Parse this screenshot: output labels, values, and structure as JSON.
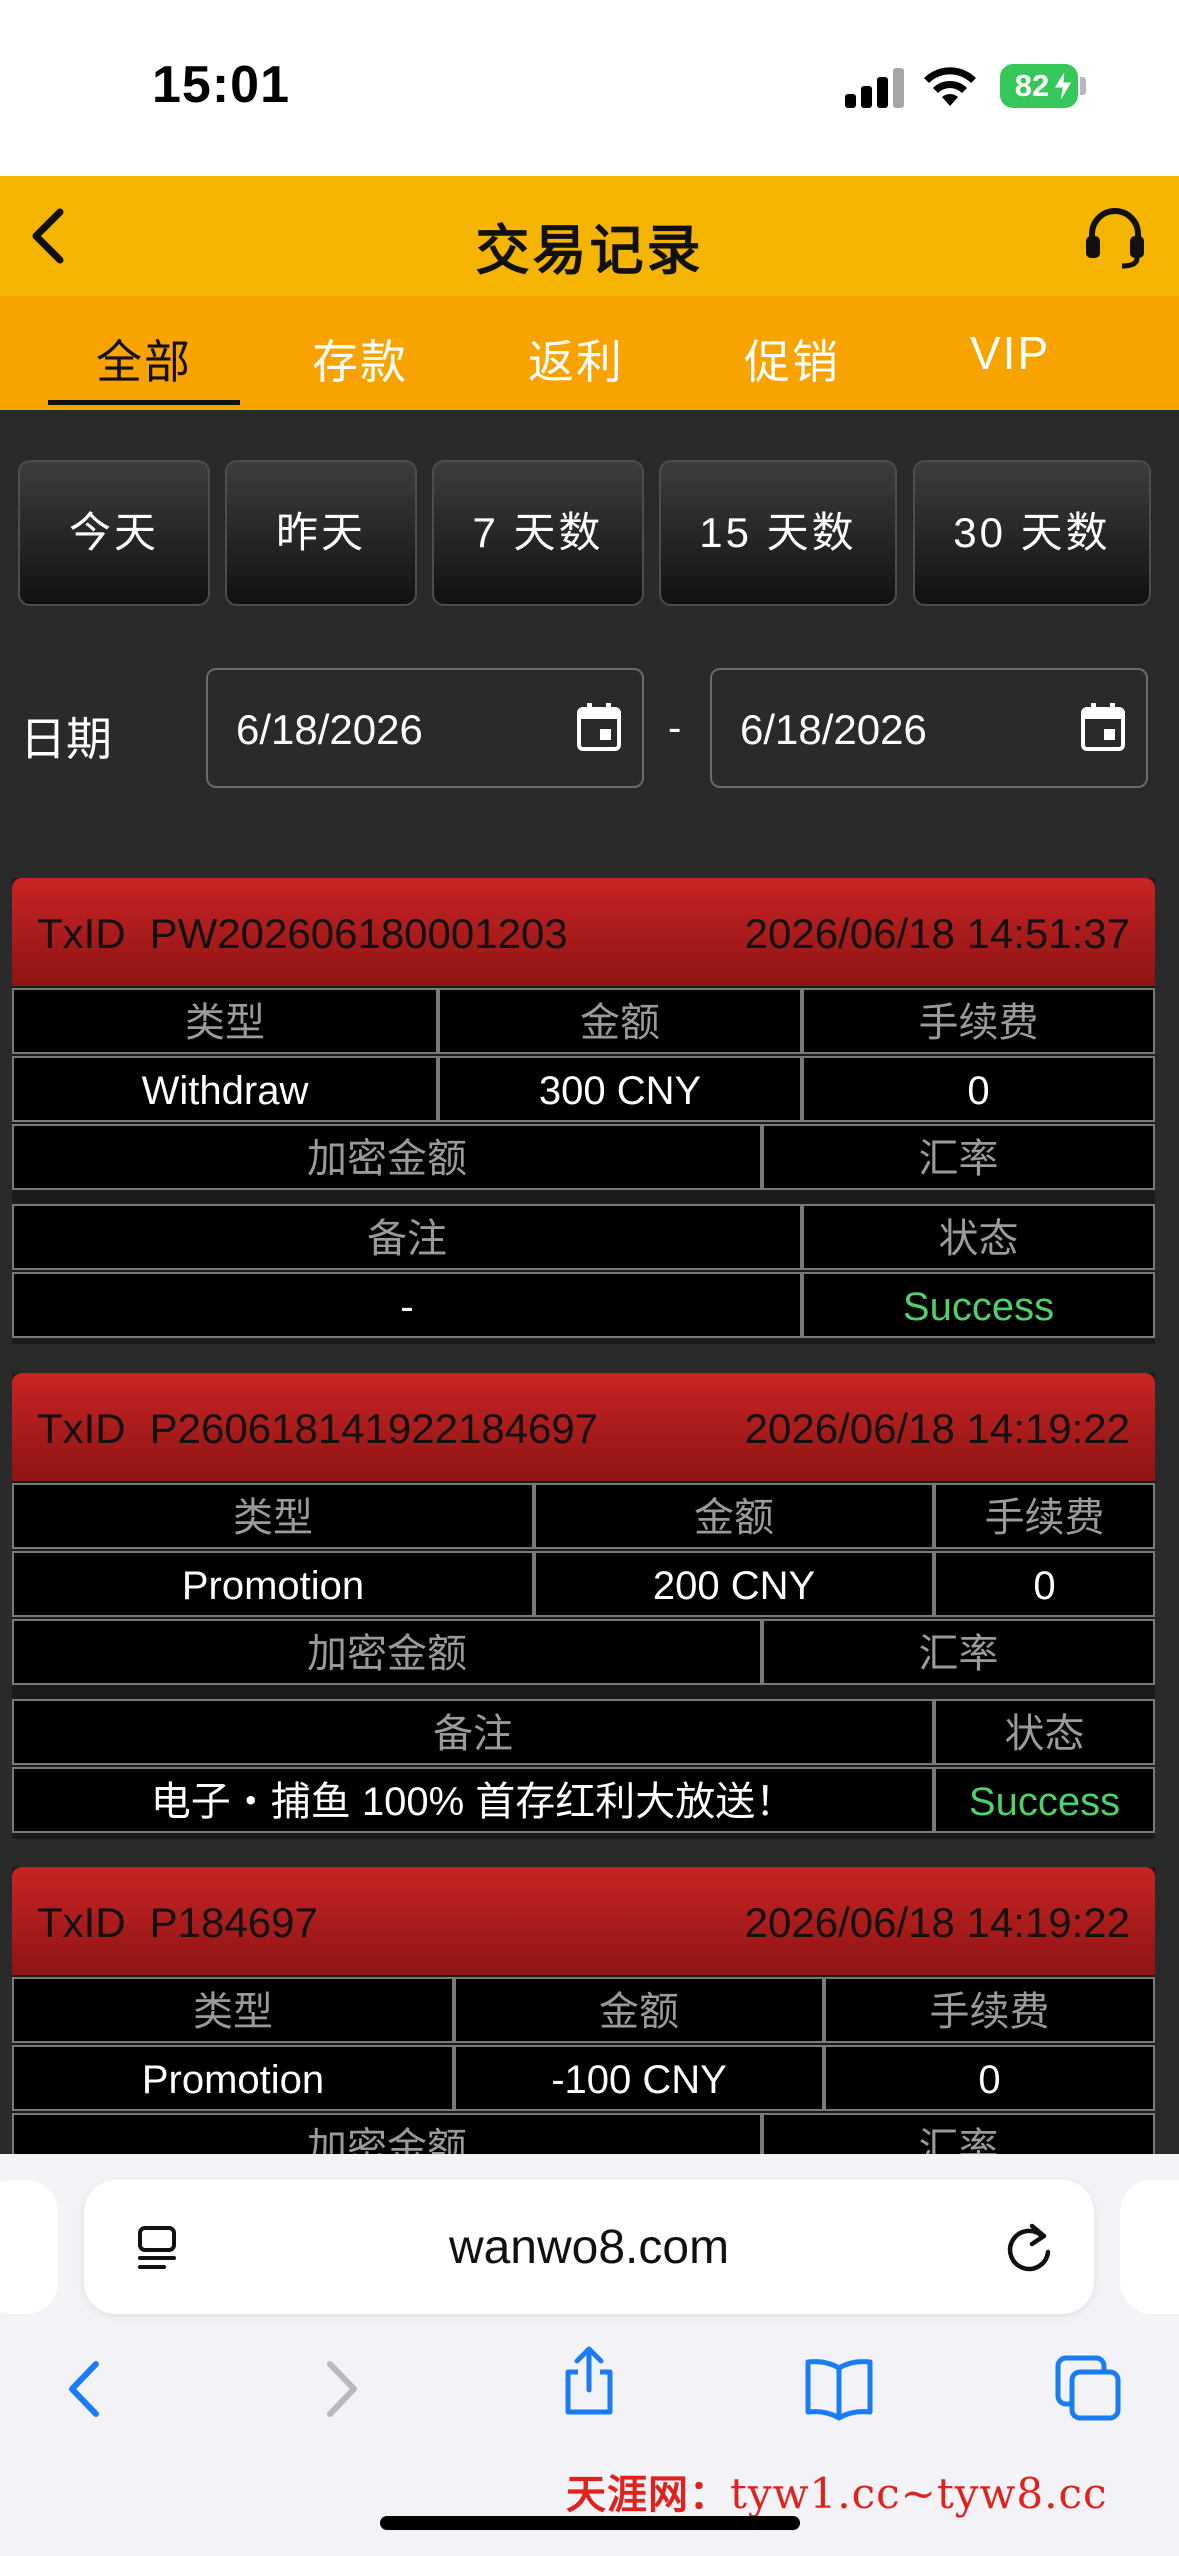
{
  "status_bar": {
    "time": "15:01",
    "battery": "82"
  },
  "header": {
    "title": "交易记录"
  },
  "tabs": [
    {
      "label": "全部",
      "active": true
    },
    {
      "label": "存款",
      "active": false
    },
    {
      "label": "返利",
      "active": false
    },
    {
      "label": "促销",
      "active": false
    },
    {
      "label": "VIP",
      "active": false
    }
  ],
  "quick_filters": [
    "今天",
    "昨天",
    "7 天数",
    "15 天数",
    "30 天数"
  ],
  "date_filter": {
    "label": "日期",
    "from": "6/18/2026",
    "separator": "-",
    "to": "6/18/2026"
  },
  "transactions": [
    {
      "txid_label": "TxID",
      "txid": "PW202606180001203",
      "time": "2026/06/18 14:51:37",
      "headers": {
        "type": "类型",
        "amount": "金额",
        "fee": "手续费",
        "crypto_amount": "加密金额",
        "rate": "汇率",
        "remark": "备注",
        "status": "状态"
      },
      "type": "Withdraw",
      "amount": "300 CNY",
      "fee": "0",
      "remark": "-",
      "status": "Success"
    },
    {
      "txid_label": "TxID",
      "txid": "P260618141922184697",
      "time": "2026/06/18 14:19:22",
      "headers": {
        "type": "类型",
        "amount": "金额",
        "fee": "手续费",
        "crypto_amount": "加密金额",
        "rate": "汇率",
        "remark": "备注",
        "status": "状态"
      },
      "type": "Promotion",
      "amount": "200 CNY",
      "fee": "0",
      "remark": "电子・捕鱼 100% 首存红利大放送！",
      "status": "Success"
    },
    {
      "txid_label": "TxID",
      "txid": "P184697",
      "time": "2026/06/18 14:19:22",
      "headers": {
        "type": "类型",
        "amount": "金额",
        "fee": "手续费",
        "crypto_amount": "加密金额",
        "rate": "汇率"
      },
      "type": "Promotion",
      "amount": "-100 CNY",
      "fee": "0"
    }
  ],
  "browser": {
    "url": "wanwo8.com"
  },
  "watermark": {
    "brand": "天涯网：",
    "url": "tyw1.cc~tyw8.cc"
  },
  "colors": {
    "header": "#f5b400",
    "tabs": "#f8a300",
    "card_head": "#c92424",
    "success": "#4fd06a"
  }
}
